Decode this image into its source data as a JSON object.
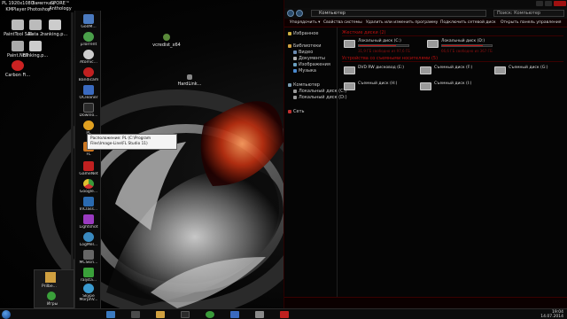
{
  "desktop": {
    "icons": [
      {
        "label": "PL 1920x1080",
        "color": "#888888"
      },
      {
        "label": "KMPlayer",
        "color": "#4a9a4a"
      },
      {
        "label": "Photoshop",
        "color": "#2a6aaa"
      },
      {
        "label": "SPORE™ Anthology",
        "color": "#3a8aaa"
      },
      {
        "label": "Заметка (08.06.2014)",
        "color": "#aaaaaa"
      },
      {
        "label": "PaintTool SAI",
        "color": "#bbbbbb"
      },
      {
        "label": "Data 2",
        "color": "#bbbbbb"
      },
      {
        "label": "ranking.p...",
        "color": "#cccccc"
      },
      {
        "label": "Paint.NET",
        "color": "#aaaaaa"
      },
      {
        "label": "ranking.p...",
        "color": "#cccccc"
      },
      {
        "label": "Carbon Fi...",
        "color": "#cc2222"
      },
      {
        "label": "vcredist_x64",
        "color": "#5a8a3a"
      },
      {
        "label": "HardLink...",
        "color": "#888888"
      }
    ],
    "tooltip": "Расположение: PL (C:\\Program Files\\Image-Line\\FL Studio 11)"
  },
  "dock": {
    "items": [
      {
        "label": "GodM...",
        "color": "#4a7ac0"
      },
      {
        "label": "µTorrent",
        "color": "#4aa04a"
      },
      {
        "label": "Atomic...",
        "color": "#cccccc"
      },
      {
        "label": "Bandicam",
        "color": "#c02020"
      },
      {
        "label": "OCleaner",
        "color": "#3a6ac0"
      },
      {
        "label": "Downlo...",
        "color": "#2a2a2a"
      },
      {
        "label": "PL",
        "color": "#e0a020"
      },
      {
        "label": "FL",
        "color": "#cc7722"
      },
      {
        "label": "GameNet",
        "color": "#c02020"
      },
      {
        "label": "Google...",
        "color": "#3a9a3a"
      },
      {
        "label": "InClass...",
        "color": "#2a6ab0"
      },
      {
        "label": "Lightshot",
        "color": "#9a3ac0"
      },
      {
        "label": "LogMeI...",
        "color": "#3a8ac0"
      },
      {
        "label": "MCSkin...",
        "color": "#666666"
      },
      {
        "label": "raljsta...",
        "color": "#3aa03a"
      },
      {
        "label": "Skype",
        "color": "#3a9ad0"
      },
      {
        "label": "MorphV...",
        "color": "#8a3ac0"
      }
    ]
  },
  "gadget": {
    "labels": [
      "Prilbe...",
      "Игры"
    ]
  },
  "explorer": {
    "address": "Компьютер",
    "search_placeholder": "Поиск: Компьютер",
    "commands": [
      "Упорядочить ▾",
      "Свойства системы",
      "Удалить или изменить программу",
      "Подключить сетевой диск",
      "Открыть панель управления"
    ],
    "nav": [
      {
        "label": "Избранное",
        "indent": 0,
        "color": "#d0b040"
      },
      {
        "label": "Библиотеки",
        "indent": 0,
        "color": "#d0a040"
      },
      {
        "label": "Видео",
        "indent": 1,
        "color": "#6a8ab0"
      },
      {
        "label": "Документы",
        "indent": 1,
        "color": "#b0b0b0"
      },
      {
        "label": "Изображения",
        "indent": 1,
        "color": "#6aa0c0"
      },
      {
        "label": "Музыка",
        "indent": 1,
        "color": "#4a8ad0"
      },
      {
        "label": "Компьютер",
        "indent": 0,
        "color": "#7a9ab0"
      },
      {
        "label": "Локальный диск (C:)",
        "indent": 1,
        "color": "#9a9a9a"
      },
      {
        "label": "Локальный диск (D:)",
        "indent": 1,
        "color": "#9a9a9a"
      },
      {
        "label": "Сеть",
        "indent": 0,
        "color": "#c03030"
      }
    ],
    "groups": [
      {
        "title": "Жесткие диски (2)",
        "drives": [
          {
            "name": "Локальный диск (C:)",
            "fill": 0.75,
            "free": "31,9 ГБ свободно из 97,6 ГБ"
          },
          {
            "name": "Локальный диск (D:)",
            "fill": 0.82,
            "free": "66,6 ГБ свободно из 367 ГБ"
          }
        ]
      },
      {
        "title": "Устройства со съемными носителями (5)",
        "drives": [
          {
            "name": "DVD RW дисковод (E:)"
          },
          {
            "name": "Съемный диск (F:)"
          },
          {
            "name": "Съемный диск (G:)"
          },
          {
            "name": "Съемный диск (H:)"
          },
          {
            "name": "Съемный диск (I:)"
          }
        ]
      }
    ]
  },
  "taskbar": {
    "apps": [
      {
        "color": "#3a7ac0"
      },
      {
        "color": "#4a4a4a"
      },
      {
        "color": "#d0a040"
      },
      {
        "color": "#2a2a2a"
      },
      {
        "color": "#3a9a3a"
      },
      {
        "color": "#3a6ac0"
      },
      {
        "color": "#8a8a8a"
      },
      {
        "color": "#c02020"
      }
    ],
    "time": "19:04",
    "date": "14.07.2014"
  }
}
